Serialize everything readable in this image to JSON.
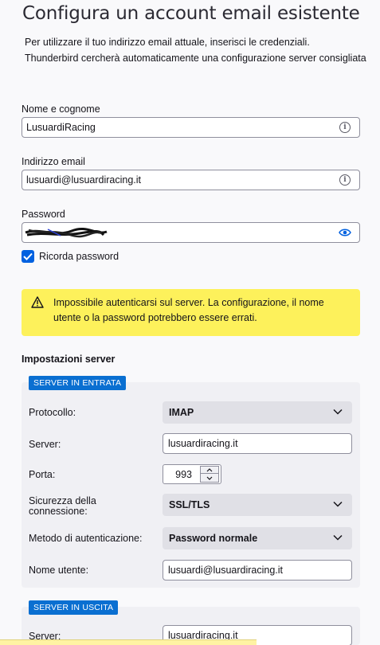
{
  "title": "Configura un account email esistente",
  "intro": {
    "line1": "Per utilizzare il tuo indirizzo email attuale, inserisci le credenziali.",
    "line2": "Thunderbird cercherà automaticamente una configurazione server consigliata"
  },
  "name_field": {
    "label": "Nome e cognome",
    "value": "LusuardiRacing"
  },
  "email_field": {
    "label": "Indirizzo email",
    "value": "lusuardi@lusuardiracing.it"
  },
  "password_field": {
    "label": "Password"
  },
  "remember_password": {
    "label": "Ricorda password",
    "checked": true
  },
  "warning": {
    "text": "Impossibile autenticarsi sul server. La configurazione, il nome utente o la password potrebbero essere errati.",
    "color": "#fdf15b"
  },
  "server_settings": {
    "title": "Impostazioni server",
    "incoming": {
      "badge": "SERVER IN ENTRATA",
      "protocol_label": "Protocollo:",
      "protocol_value": "IMAP",
      "server_label": "Server:",
      "server_value": "lusuardiracing.it",
      "port_label": "Porta:",
      "port_value": "993",
      "security_label_1": "Sicurezza della",
      "security_label_2": "connessione:",
      "security_value": "SSL/TLS",
      "auth_label": "Metodo di autenticazione:",
      "auth_value": "Password normale",
      "username_label": "Nome utente:",
      "username_value": "lusuardi@lusuardiracing.it"
    },
    "outgoing": {
      "badge": "SERVER IN USCITA",
      "server_label": "Server:",
      "server_value": "lusuardiracing.it"
    }
  },
  "colors": {
    "accent": "#0a6fd1",
    "checkbox": "#0061e0",
    "eye_icon": "#0061e0"
  }
}
